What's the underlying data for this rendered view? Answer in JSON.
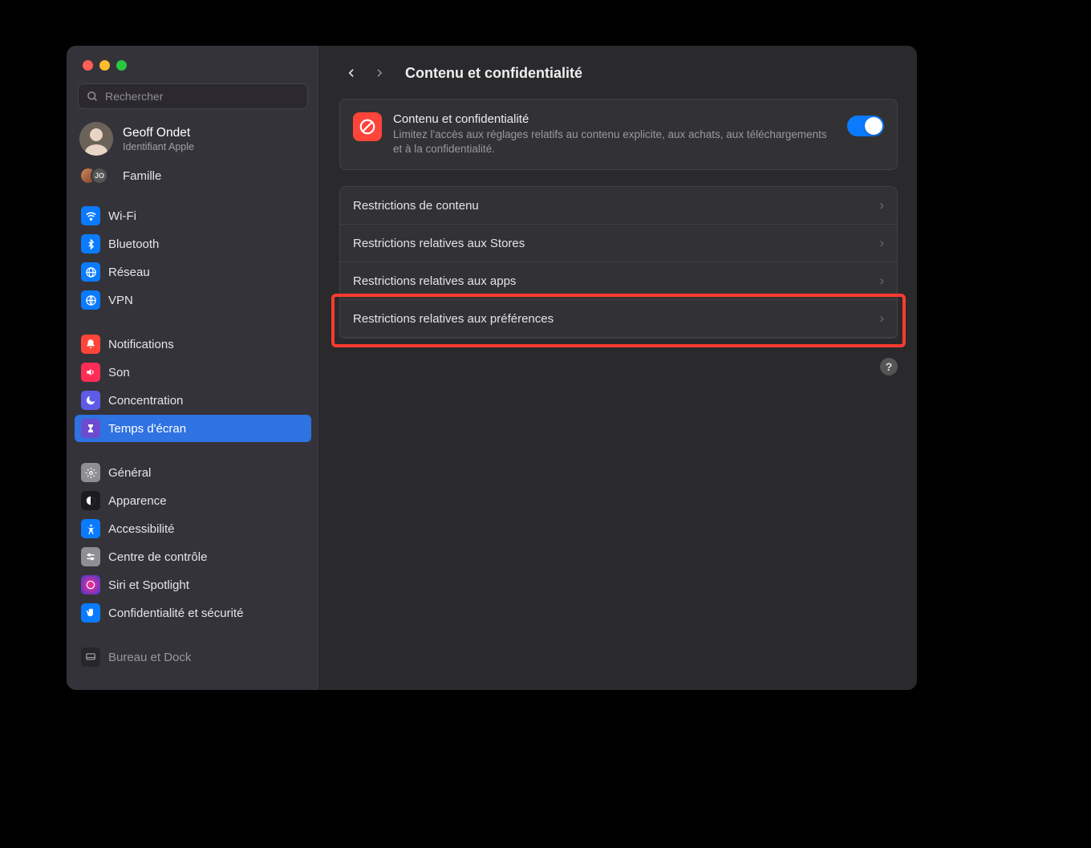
{
  "search": {
    "placeholder": "Rechercher"
  },
  "account": {
    "name": "Geoff Ondet",
    "subtitle": "Identifiant Apple"
  },
  "family": {
    "label": "Famille",
    "badge": "JO"
  },
  "sidebar": {
    "group1": [
      {
        "label": "Wi-Fi"
      },
      {
        "label": "Bluetooth"
      },
      {
        "label": "Réseau"
      },
      {
        "label": "VPN"
      }
    ],
    "group2": [
      {
        "label": "Notifications"
      },
      {
        "label": "Son"
      },
      {
        "label": "Concentration"
      },
      {
        "label": "Temps d'écran"
      }
    ],
    "group3": [
      {
        "label": "Général"
      },
      {
        "label": "Apparence"
      },
      {
        "label": "Accessibilité"
      },
      {
        "label": "Centre de contrôle"
      },
      {
        "label": "Siri et Spotlight"
      },
      {
        "label": "Confidentialité et sécurité"
      }
    ],
    "group4": [
      {
        "label": "Bureau et Dock"
      }
    ]
  },
  "page": {
    "title": "Contenu et confidentialité",
    "hero": {
      "title": "Contenu et confidentialité",
      "description": "Limitez l'accès aux réglages relatifs au contenu explicite, aux achats, aux téléchargements et à la confidentialité.",
      "toggle_on": true
    },
    "rows": [
      {
        "label": "Restrictions de contenu"
      },
      {
        "label": "Restrictions relatives aux Stores"
      },
      {
        "label": "Restrictions relatives aux apps"
      },
      {
        "label": "Restrictions relatives aux préférences",
        "highlighted": true
      }
    ],
    "help": "?"
  }
}
